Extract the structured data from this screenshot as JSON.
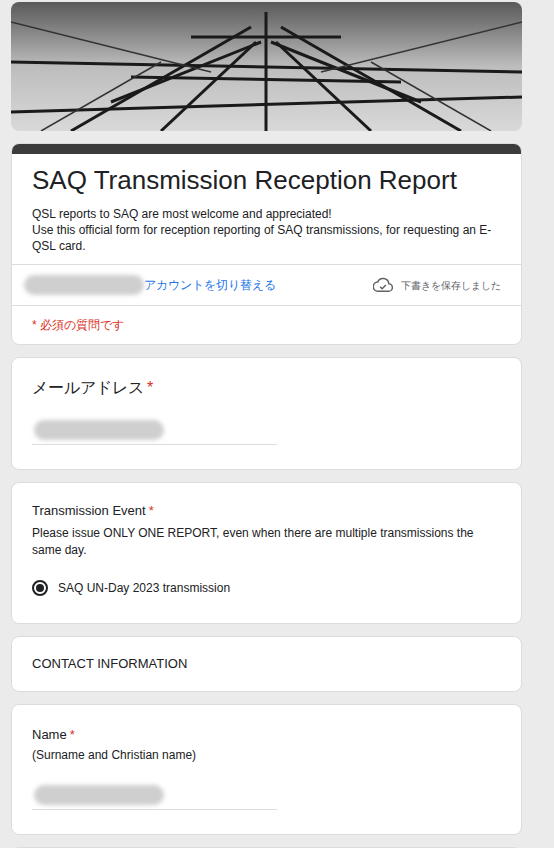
{
  "form": {
    "title": "SAQ Transmission Reception Report",
    "description": [
      "QSL reports to SAQ are most welcome and appreciated!",
      "Use this official form for reception reporting of SAQ transmissions, for requesting an E-QSL card."
    ]
  },
  "account": {
    "switch_label": "アカウントを切り替える",
    "draft_status": "下書きを保存しました"
  },
  "required_note": "* 必須の質問です",
  "required_mark": "*",
  "questions": [
    {
      "kind": "email",
      "label": "メールアドレス",
      "required": true
    },
    {
      "kind": "radio",
      "label": "Transmission Event",
      "required": true,
      "description": "Please issue ONLY ONE REPORT, even when there are multiple transmissions the same day.",
      "options": [
        {
          "label": "SAQ UN-Day 2023 transmission",
          "selected": true
        }
      ]
    },
    {
      "kind": "section",
      "label": "CONTACT INFORMATION"
    },
    {
      "kind": "text",
      "label": "Name",
      "required": true,
      "description": "(Surname and Christian name)"
    },
    {
      "kind": "partial"
    }
  ]
}
